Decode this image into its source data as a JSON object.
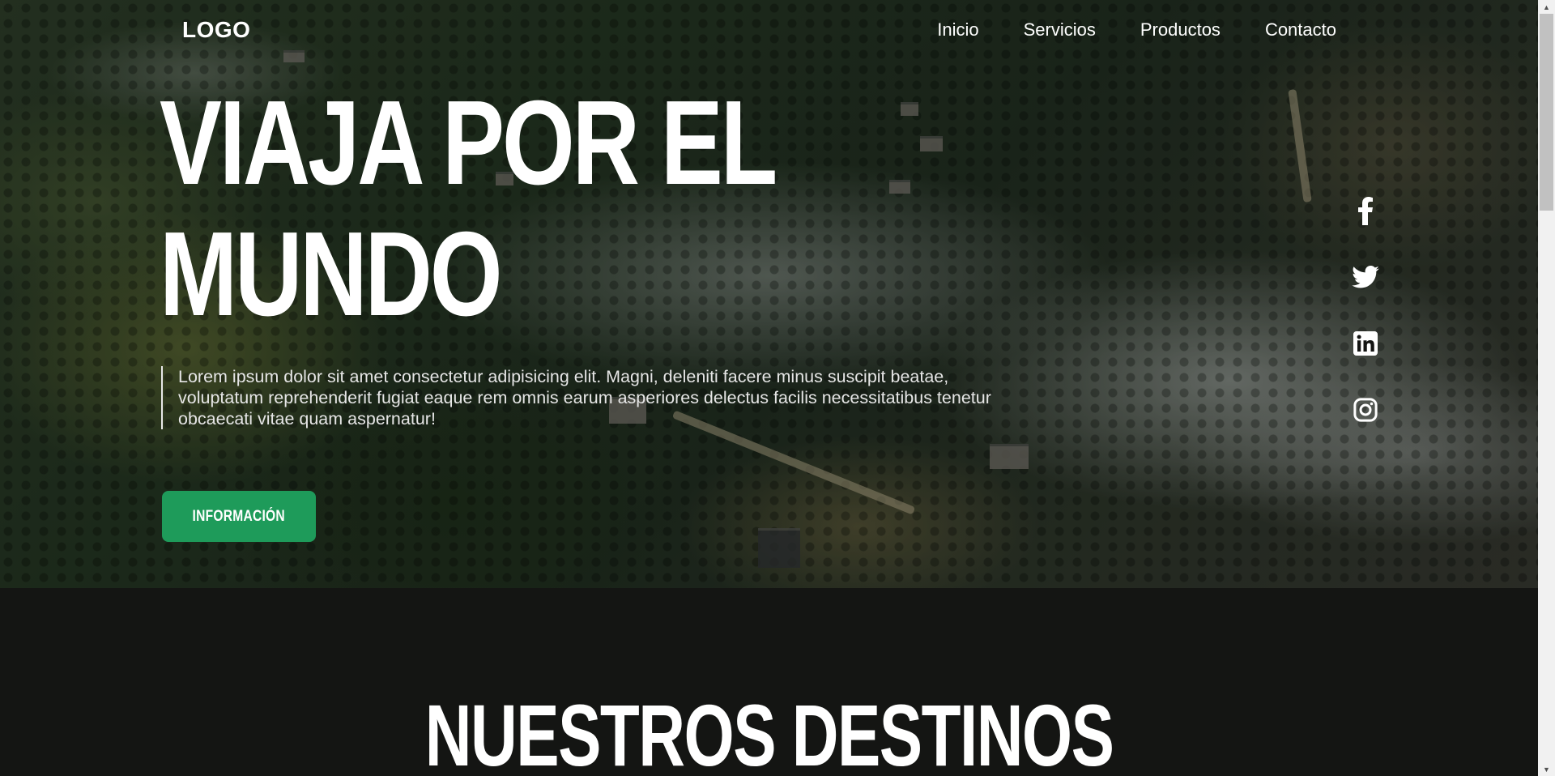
{
  "header": {
    "logo": "LOGO",
    "nav": [
      {
        "label": "Inicio"
      },
      {
        "label": "Servicios"
      },
      {
        "label": "Productos"
      },
      {
        "label": "Contacto"
      }
    ]
  },
  "hero": {
    "title_line1": "VIAJA POR EL",
    "title_line2": "MUNDO",
    "description": "Lorem ipsum dolor sit amet consectetur adipisicing elit. Magni, deleniti facere minus suscipit beatae, voluptatum reprehenderit fugiat eaque rem omnis earum asperiores delectus facilis necessitatibus tenetur obcaecati vitae quam aspernatur!",
    "button_label": "INFORMACIÓN"
  },
  "social": [
    {
      "icon": "facebook-icon"
    },
    {
      "icon": "twitter-icon"
    },
    {
      "icon": "linkedin-icon"
    },
    {
      "icon": "instagram-icon"
    }
  ],
  "destinos": {
    "title": "NUESTROS DESTINOS"
  },
  "colors": {
    "accent": "#1e9b5a",
    "section_background": "#141513",
    "text": "#ffffff"
  }
}
